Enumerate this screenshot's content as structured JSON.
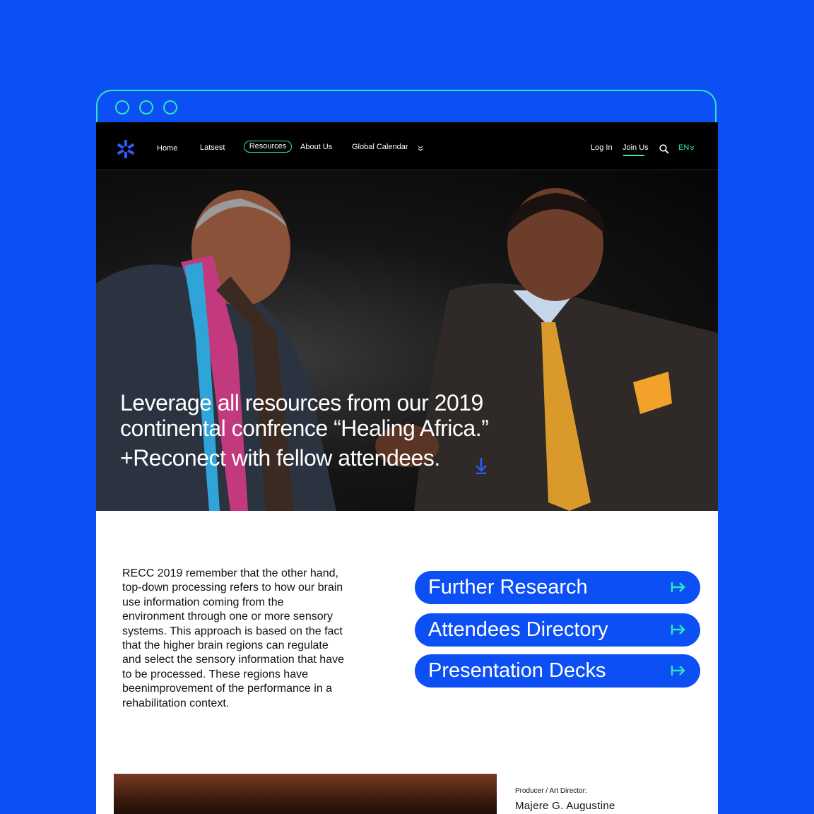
{
  "nav": {
    "home": "Home",
    "latest": "Latsest",
    "resources": "Resources",
    "about": "About Us",
    "calendar": "Global Calendar",
    "login": "Log In",
    "join": "Join Us",
    "lang": "EN"
  },
  "hero": {
    "line1": "Leverage all resources from our 2019",
    "line2": "continental confrence “Healing Africa.”",
    "line3": "+Reconect with fellow attendees."
  },
  "body": {
    "text": "RECC 2019 remember that the other hand, top-down processing refers to how our brain use information coming from the environment through one or more sensory systems. This approach is based on the fact that the higher brain regions can regulate and select the sensory information that have to be processed. These regions have beenimprovement of the performance in a rehabilitation context."
  },
  "ctas": [
    "Further Research",
    "Attendees Directory",
    "Presentation Decks"
  ],
  "credit": {
    "label": "Producer / Art Director:",
    "name": "Majere G. Augustine"
  },
  "colors": {
    "brand_blue": "#0b4ff5",
    "accent_mint": "#2ee6c0",
    "nav_bg": "#000000"
  },
  "icons": {
    "logo": "asterisk-logo-icon",
    "calendar_dropdown": "double-chevron-down-icon",
    "search": "search-icon",
    "scroll": "arrow-down-to-line-icon",
    "cta": "arrow-right-from-line-icon"
  }
}
